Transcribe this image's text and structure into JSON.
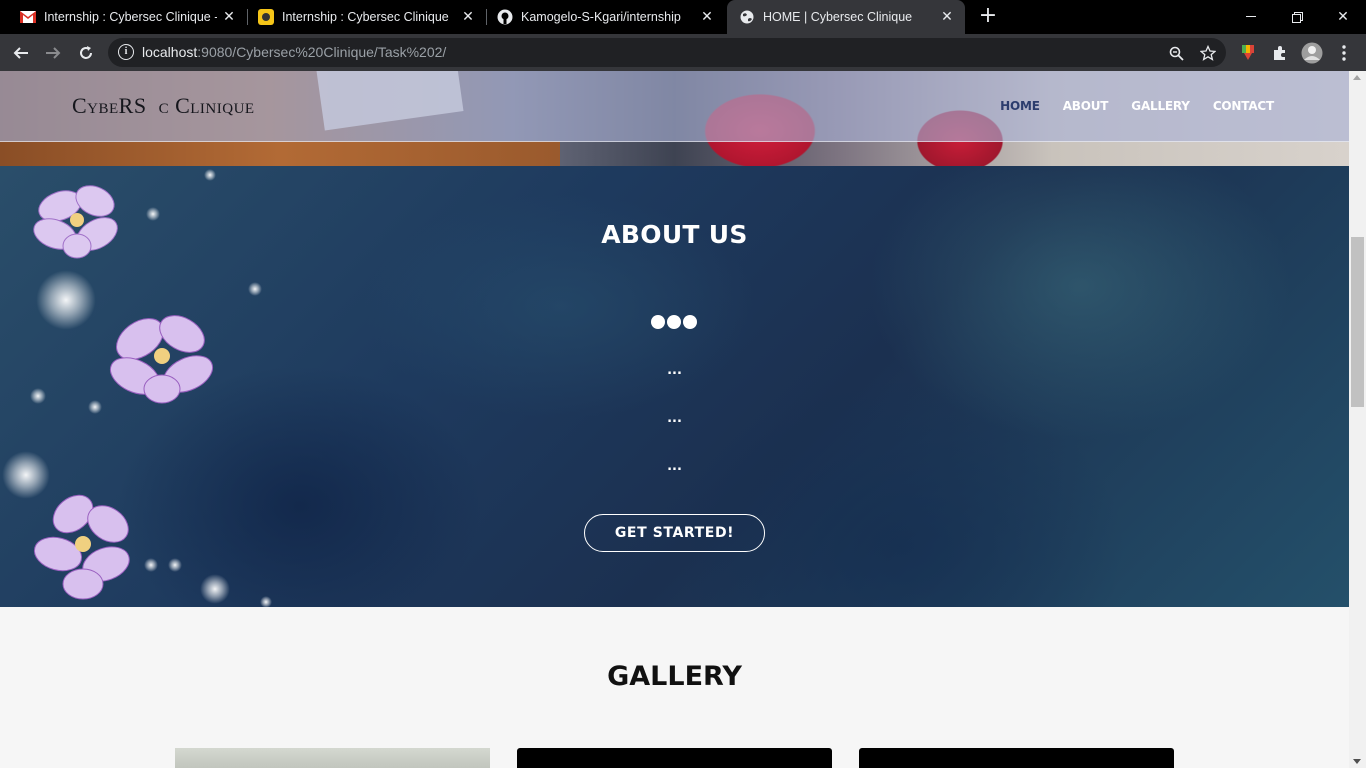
{
  "browser": {
    "tabs": [
      {
        "title": "Internship : Cybersec Clinique - k",
        "icon": "gmail-icon",
        "active": false
      },
      {
        "title": "Internship : Cybersec Clinique",
        "icon": "trello-app-icon",
        "active": false
      },
      {
        "title": "Kamogelo-S-Kgari/internship",
        "icon": "github-icon",
        "active": false
      },
      {
        "title": "HOME | Cybersec Clinique",
        "icon": "globe-icon",
        "active": true
      }
    ],
    "address": {
      "host": "localhost",
      "rest": ":9080/Cybersec%20Clinique/Task%202/"
    }
  },
  "site": {
    "logo": "CybeRS  c Clinique",
    "nav": [
      "HOME",
      "ABOUT",
      "GALLERY",
      "CONTACT"
    ],
    "active_nav": "HOME"
  },
  "about": {
    "title": "ABOUT US",
    "lines": [
      "...",
      "...",
      "..."
    ],
    "cta": "GET STARTED!"
  },
  "gallery": {
    "title": "GALLERY"
  },
  "colors": {
    "nav_active": "#2c3d6e",
    "chrome_dark": "#35363a"
  }
}
